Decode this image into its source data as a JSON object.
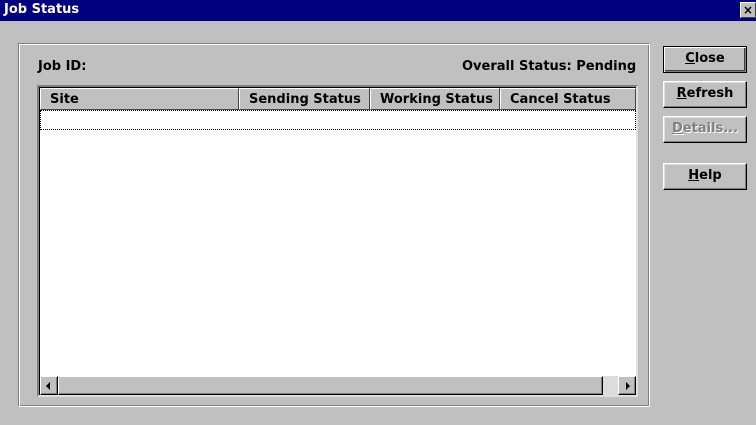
{
  "window": {
    "title": "Job Status",
    "close_glyph": "×"
  },
  "header": {
    "job_id_label": "Job ID:",
    "overall_status": "Overall Status: Pending"
  },
  "list": {
    "columns": [
      "Site",
      "Sending Status",
      "Working Status",
      "Cancel Status"
    ],
    "rows": []
  },
  "buttons": {
    "close": {
      "mnemonic": "C",
      "rest": "lose"
    },
    "refresh": {
      "mnemonic": "R",
      "rest": "efresh"
    },
    "details": {
      "mnemonic": "D",
      "rest": "etails...",
      "enabled": false
    },
    "help": {
      "mnemonic": "H",
      "rest": "elp"
    }
  },
  "icons": {
    "scroll_left": "scroll-left-arrow-icon",
    "scroll_right": "scroll-right-arrow-icon",
    "window_close": "close-icon"
  },
  "colors": {
    "titlebar": "#000080",
    "face": "#c0c0c0",
    "disabled_text": "#808080"
  }
}
